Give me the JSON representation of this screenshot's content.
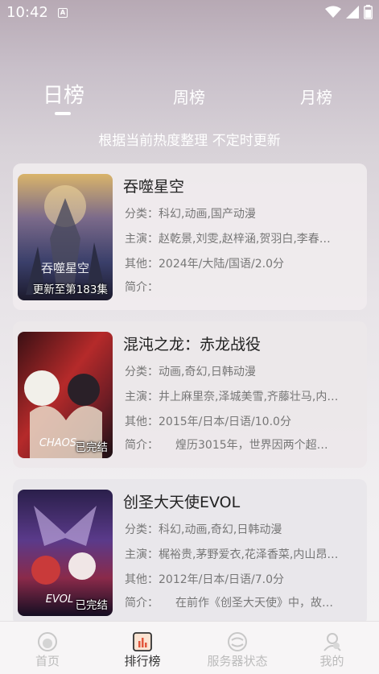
{
  "status": {
    "time": "10:42",
    "notif": "A"
  },
  "tabs": {
    "day": "日榜",
    "week": "周榜",
    "month": "月榜"
  },
  "subtitle": "根据当前热度整理 不定时更新",
  "items": [
    {
      "title": "吞噬星空",
      "genre": "分类：科幻,动画,国产动漫",
      "cast": "主演：赵乾景,刘雯,赵梓涵,贺羽白,李春…",
      "other": "其他：2024年/大陆/国语/2.0分",
      "intro": "简介：",
      "badge": "更新至第183集",
      "poster_text": "吞噬星空"
    },
    {
      "title": "混沌之龙：赤龙战役",
      "genre": "分类：动画,奇幻,日韩动漫",
      "cast": "主演：井上麻里奈,泽城美雪,齐藤壮马,内…",
      "other": "其他：2015年/日本/日语/10.0分",
      "intro": "简介：　　煌历3015年，世界因两个超…",
      "badge": "已完结",
      "poster_text": "CHAOS"
    },
    {
      "title": "创圣大天使EVOL",
      "genre": "分类：科幻,动画,奇幻,日韩动漫",
      "cast": "主演：梶裕贵,茅野爱衣,花泽香菜,内山昂…",
      "other": "其他：2012年/日本/日语/7.0分",
      "intro": "简介：　　在前作《创圣大天使》中，故…",
      "badge": "已完结",
      "poster_text": "EVOL"
    }
  ],
  "nav": {
    "home": "首页",
    "rank": "排行榜",
    "server": "服务器状态",
    "mine": "我的"
  }
}
